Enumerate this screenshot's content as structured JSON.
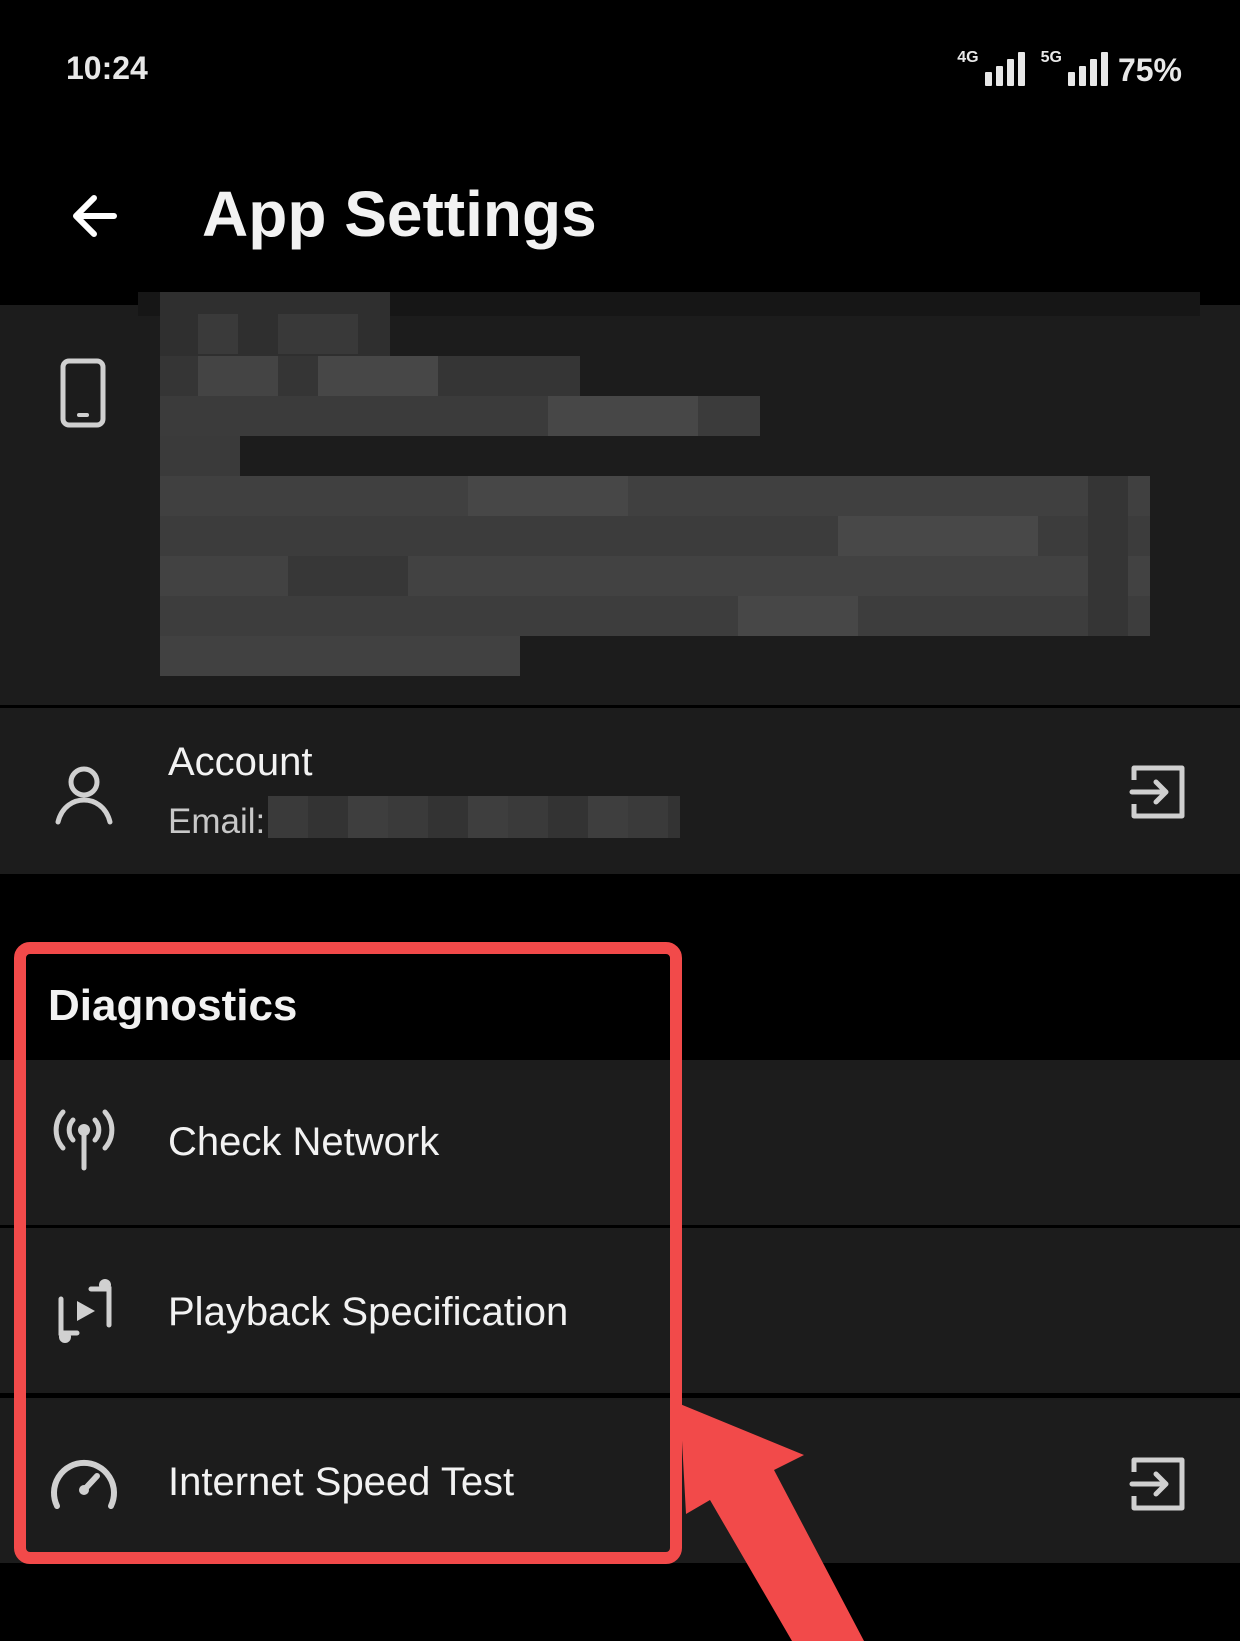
{
  "status_bar": {
    "time": "10:24",
    "network_1": "4G",
    "network_2": "5G",
    "battery": "75%"
  },
  "header": {
    "title": "App Settings",
    "back_icon": "arrow-left-icon"
  },
  "device_card": {
    "icon": "smartphone-icon"
  },
  "account": {
    "label": "Account",
    "email_label": "Email:",
    "icon": "person-icon",
    "action_icon": "exit-icon"
  },
  "diagnostics": {
    "title": "Diagnostics",
    "items": [
      {
        "label": "Check Network",
        "icon": "antenna-icon"
      },
      {
        "label": "Playback Specification",
        "icon": "playback-spec-icon"
      },
      {
        "label": "Internet Speed Test",
        "icon": "speedometer-icon",
        "action_icon": "exit-icon"
      }
    ]
  },
  "colors": {
    "background": "#000000",
    "row_background": "#1c1c1c",
    "text": "#f2f2f2",
    "annotation": "#f24a4a"
  }
}
